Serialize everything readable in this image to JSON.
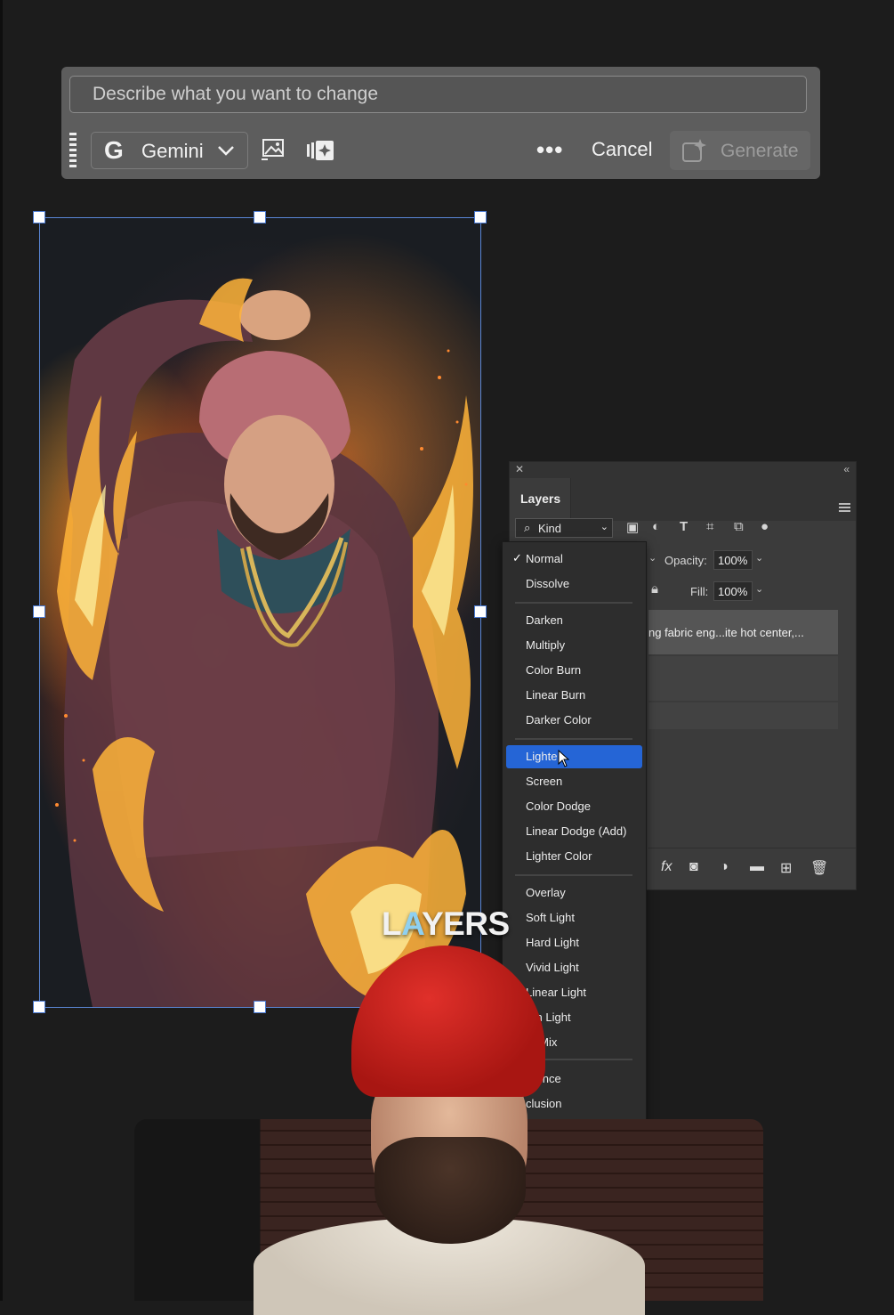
{
  "genfill": {
    "prompt_placeholder": "Describe what you want to change",
    "model": "Gemini",
    "cancel_label": "Cancel",
    "generate_label": "Generate",
    "more_label": "•••"
  },
  "layers_panel": {
    "tab": "Layers",
    "filter_kind": "Kind",
    "opacity_label": "Opacity:",
    "opacity_value": "100%",
    "fill_label": "Fill:",
    "fill_value": "100%",
    "layer_name": "ng fabric eng...ite hot center,..."
  },
  "blend_modes": {
    "selected": "Normal",
    "highlighted": "Lighten",
    "items": [
      "Normal",
      "Dissolve",
      "Darken",
      "Multiply",
      "Color Burn",
      "Linear Burn",
      "Darker Color",
      "Lighte",
      "Screen",
      "Color Dodge",
      "Linear Dodge (Add)",
      "Lighter Color",
      "Overlay",
      "Soft Light",
      "Hard Light",
      "Vivid Light",
      "Linear Light",
      "Pin Light",
      "rd Mix",
      "erence",
      "clusion"
    ],
    "checkmark": "✓"
  },
  "caption": {
    "part1": "L",
    "part2": "A",
    "part3": "YERS"
  },
  "icons": {
    "google": "G",
    "chevron": "chevron-down-icon",
    "fx": "fx"
  }
}
